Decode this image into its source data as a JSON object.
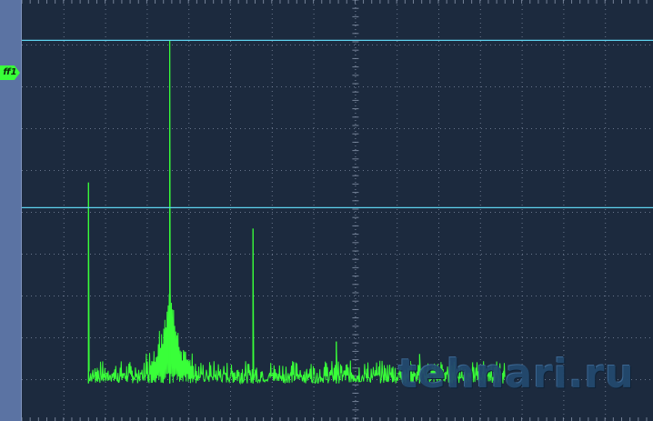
{
  "channel_marker": {
    "label": "ff1"
  },
  "watermark": {
    "text": "tehnari.ru"
  },
  "colors": {
    "background": "#1c2a3e",
    "rail": "#5b73a3",
    "trace": "#39ff39",
    "cursor": "#5fd3ef",
    "grid": "#8a97ad"
  },
  "chart_data": {
    "type": "line",
    "title": "",
    "xlabel": "",
    "ylabel": "",
    "x_divisions": 15,
    "y_divisions": 10,
    "x_range": [
      0,
      15
    ],
    "y_range": [
      0,
      10
    ],
    "noise_floor": 0.9,
    "spectrum_x_range": [
      1.6,
      11.6
    ],
    "peaks": [
      {
        "x": 1.6,
        "y": 5.7
      },
      {
        "x": 3.55,
        "y": 9.1
      },
      {
        "x": 3.55,
        "y": 6.5
      },
      {
        "x": 5.55,
        "y": 4.6
      },
      {
        "x": 7.55,
        "y": 1.9
      },
      {
        "x": 9.55,
        "y": 1.6
      },
      {
        "x": 11.55,
        "y": 1.1
      }
    ],
    "cursors_y": [
      9.1,
      5.1
    ]
  }
}
